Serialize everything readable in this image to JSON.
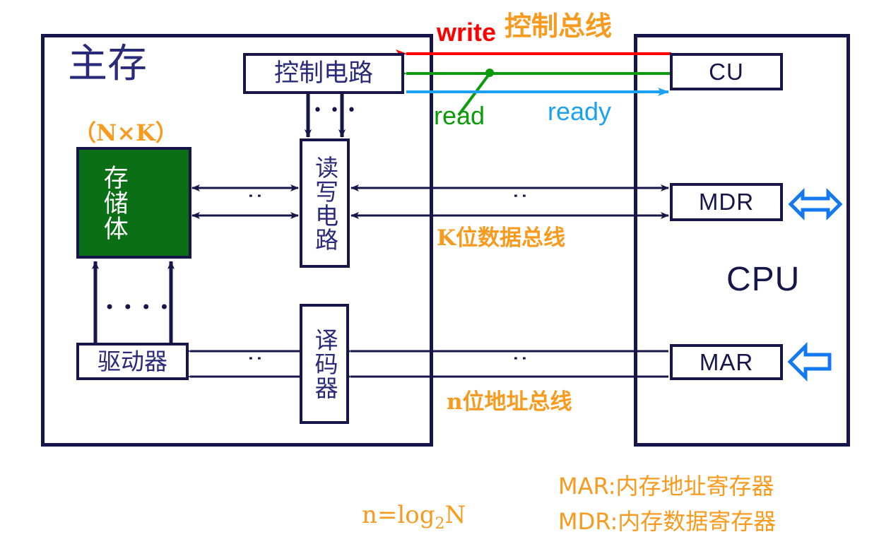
{
  "diagram": {
    "title_main_memory": "主存",
    "capacity_note": "（N×K）",
    "blocks": {
      "storage_body": "存储体",
      "control_circuit": "控制电路",
      "read_write_circuit": "读写电路",
      "decoder": "译码器",
      "driver": "驱动器",
      "cu": "CU",
      "mdr": "MDR",
      "mar": "MAR",
      "cpu": "CPU"
    },
    "signals": {
      "write": "write",
      "read": "read",
      "ready": "ready",
      "control_bus": "控制总线"
    },
    "buses": {
      "data_bus": "K位数据总线",
      "address_bus": "n位地址总线"
    },
    "legend": {
      "formula": "n=log",
      "formula_sub": "2",
      "formula_tail": "N",
      "mar_expand": "MAR:内存地址寄存器",
      "mdr_expand": "MDR:内存数据寄存器"
    },
    "ellipsis": {
      "vertical": ":",
      "horizontal_three": "• • •",
      "horizontal_four": "• • • •"
    },
    "colors": {
      "outline": "#16164a",
      "text_blue": "#2a2a7a",
      "storage_fill": "#0b7015",
      "orange": "#f79a1e",
      "write_red": "#ff0000",
      "read_green": "#0b9b0b",
      "ready_blue": "#1ba1f2"
    }
  }
}
